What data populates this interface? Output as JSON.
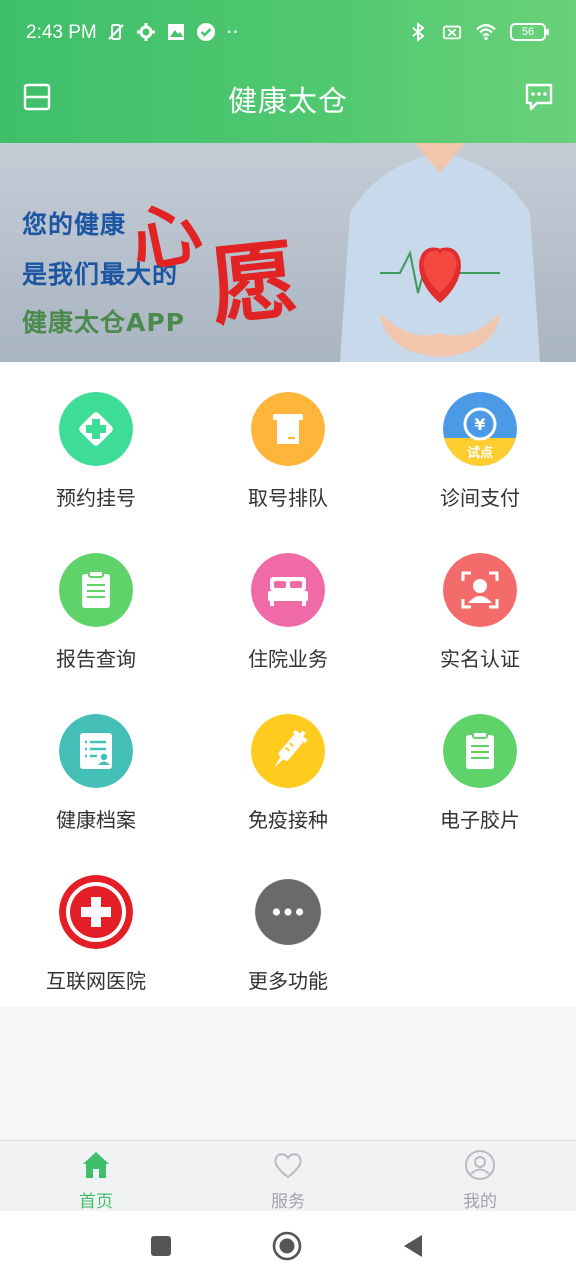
{
  "status_bar": {
    "time": "2:43 PM",
    "dots": "··",
    "battery": "56"
  },
  "app_bar": {
    "title": "健康太仓"
  },
  "banner": {
    "line1": "您的健康",
    "line2": "是我们最大的",
    "line3": "健康太仓APP",
    "calligraphy": "心愿"
  },
  "services": [
    {
      "label": "预约挂号",
      "icon": "plus-hospital-icon",
      "color": "#3ddc97"
    },
    {
      "label": "取号排队",
      "icon": "ticket-machine-icon",
      "color": "#ffb43a"
    },
    {
      "label": "诊间支付",
      "icon": "yuan-coin-icon",
      "color": "#4b9ae6",
      "badge": "试点"
    },
    {
      "label": "报告查询",
      "icon": "clipboard-icon",
      "color": "#5fd36a"
    },
    {
      "label": "住院业务",
      "icon": "bed-icon",
      "color": "#ef6aa7"
    },
    {
      "label": "实名认证",
      "icon": "face-id-icon",
      "color": "#f46b6b"
    },
    {
      "label": "健康档案",
      "icon": "health-record-icon",
      "color": "#44bfb8"
    },
    {
      "label": "免疫接种",
      "icon": "syringe-icon",
      "color": "#ffcb1f"
    },
    {
      "label": "电子胶片",
      "icon": "film-clipboard-icon",
      "color": "#5fd36a"
    },
    {
      "label": "互联网医院",
      "icon": "red-cross-icon",
      "color": "#e41e26"
    },
    {
      "label": "更多功能",
      "icon": "more-dots-icon",
      "color": "#6a6a6a"
    }
  ],
  "tab_bar": {
    "active_color": "#3fbf6b",
    "inactive_color": "#a1a3a8",
    "tabs": [
      {
        "label": "首页",
        "icon": "home-icon",
        "active": true
      },
      {
        "label": "服务",
        "icon": "heart-icon",
        "active": false
      },
      {
        "label": "我的",
        "icon": "user-icon",
        "active": false
      }
    ]
  }
}
